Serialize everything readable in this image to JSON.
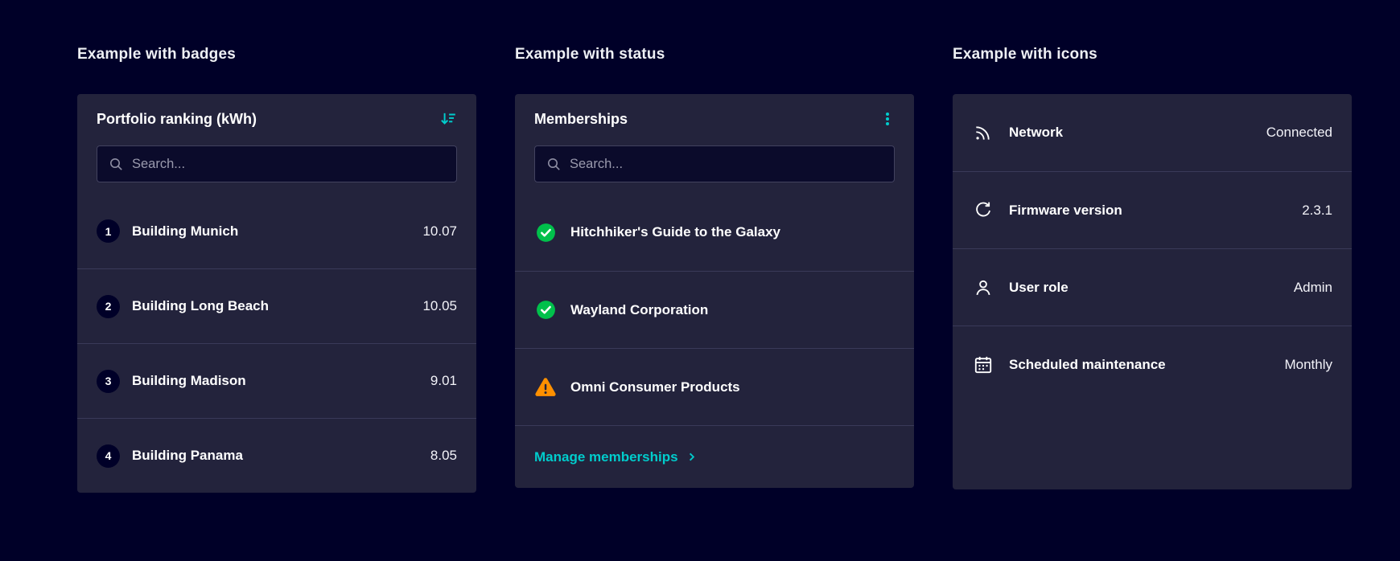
{
  "headings": {
    "badges": "Example with badges",
    "status": "Example with status",
    "icons": "Example with icons"
  },
  "colors": {
    "page_bg": "#000028",
    "card_bg": "#23233c",
    "accent_teal": "#00cccc",
    "success_green": "#00c04b",
    "warning_orange": "#ff9000"
  },
  "badges_card": {
    "title": "Portfolio ranking (kWh)",
    "header_icon": "sort-descending-icon",
    "search": {
      "placeholder": "Search..."
    },
    "rows": [
      {
        "badge": "1",
        "label": "Building Munich",
        "value": "10.07"
      },
      {
        "badge": "2",
        "label": "Building Long Beach",
        "value": "10.05"
      },
      {
        "badge": "3",
        "label": "Building Madison",
        "value": "9.01"
      },
      {
        "badge": "4",
        "label": "Building Panama",
        "value": "8.05"
      }
    ]
  },
  "status_card": {
    "title": "Memberships",
    "header_icon": "kebab-menu-icon",
    "search": {
      "placeholder": "Search..."
    },
    "rows": [
      {
        "status": "success",
        "status_icon": "check-circle-icon",
        "label": "Hitchhiker's Guide to the Galaxy"
      },
      {
        "status": "success",
        "status_icon": "check-circle-icon",
        "label": "Wayland Corporation"
      },
      {
        "status": "warning",
        "status_icon": "warning-triangle-icon",
        "label": "Omni Consumer Products"
      }
    ],
    "footer_link": "Manage memberships"
  },
  "icons_card": {
    "rows": [
      {
        "icon": "network-icon",
        "label": "Network",
        "value": "Connected"
      },
      {
        "icon": "firmware-icon",
        "label": "Firmware version",
        "value": "2.3.1"
      },
      {
        "icon": "user-icon",
        "label": "User role",
        "value": "Admin"
      },
      {
        "icon": "calendar-icon",
        "label": "Scheduled maintenance",
        "value": "Monthly"
      }
    ]
  }
}
